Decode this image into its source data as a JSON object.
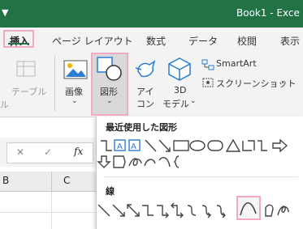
{
  "titlebar": {
    "qat_icon": "dropdown-arrow-icon",
    "title": "Book1 - Exce"
  },
  "tabs": [
    "挿入",
    "ページ レイアウト",
    "数式",
    "データ",
    "校閲",
    "表示"
  ],
  "ribbon": {
    "partial_left_label": "ル",
    "table_label": "テーブル",
    "image_label": "画像",
    "shapes_label": "図形",
    "icon_label_1": "アイ",
    "icon_label_2": "コン",
    "model3d_label_1": "3D",
    "model3d_label_2": "モデル",
    "smartart_label": "SmartArt",
    "screenshot_label": "スクリーンショット"
  },
  "formulabar": {
    "cancel": "✕",
    "enter": "✓",
    "fx": "fx"
  },
  "grid": {
    "columns": [
      "B",
      "C"
    ]
  },
  "dropdown": {
    "recent_header": "最近使用した図形",
    "lines_header": "線"
  },
  "colors": {
    "excel_green": "#217346",
    "highlight_pink": "#f2a9c3",
    "icon_blue": "#2b7cd3"
  }
}
